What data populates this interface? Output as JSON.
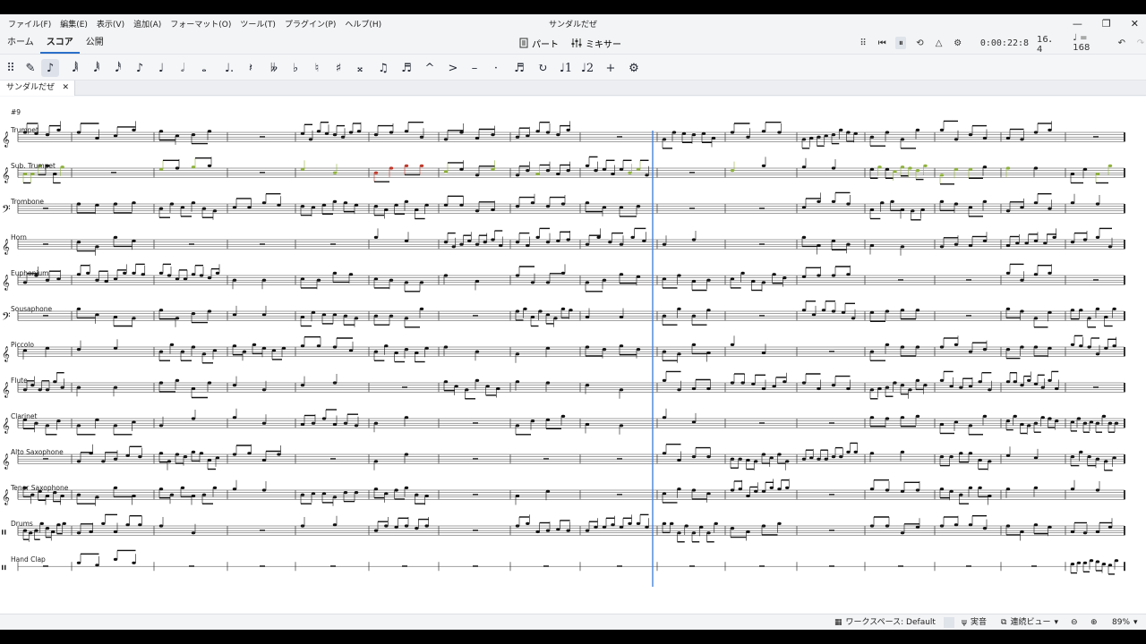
{
  "window": {
    "title": "サンダルだぜ",
    "menus": [
      "ファイル(F)",
      "編集(E)",
      "表示(V)",
      "追加(A)",
      "フォーマット(O)",
      "ツール(T)",
      "プラグイン(P)",
      "ヘルプ(H)"
    ],
    "controls": {
      "minimize": "—",
      "maximize": "❐",
      "close": "✕"
    }
  },
  "nav": {
    "tabs": [
      {
        "label": "ホーム",
        "active": false
      },
      {
        "label": "スコア",
        "active": true
      },
      {
        "label": "公開",
        "active": false
      }
    ],
    "parts_label": "パート",
    "mixer_label": "ミキサー"
  },
  "transport": {
    "time": "0:00:22:8",
    "measure_beat": "16．4",
    "tempo": "♩ = 168"
  },
  "toolbar": {
    "tools": [
      {
        "name": "grip-icon",
        "glyph": "⠿"
      },
      {
        "name": "pen-icon",
        "glyph": "✎"
      },
      {
        "name": "note-input-icon",
        "glyph": "♪"
      },
      {
        "name": "64th-note-icon",
        "glyph": "𝅘𝅥𝅲"
      },
      {
        "name": "32nd-note-icon",
        "glyph": "𝅘𝅥𝅱"
      },
      {
        "name": "16th-note-icon",
        "glyph": "𝅘𝅥𝅰"
      },
      {
        "name": "eighth-note-icon",
        "glyph": "♪"
      },
      {
        "name": "quarter-note-icon",
        "glyph": "♩"
      },
      {
        "name": "half-note-icon",
        "glyph": "𝅗𝅥"
      },
      {
        "name": "whole-note-icon",
        "glyph": "𝅝"
      },
      {
        "name": "dotted-note-icon",
        "glyph": "♩."
      },
      {
        "name": "rest-icon",
        "glyph": "𝄽"
      },
      {
        "name": "double-flat-icon",
        "glyph": "𝄫"
      },
      {
        "name": "flat-icon",
        "glyph": "♭"
      },
      {
        "name": "natural-icon",
        "glyph": "♮"
      },
      {
        "name": "sharp-icon",
        "glyph": "♯"
      },
      {
        "name": "double-sharp-icon",
        "glyph": "𝄪"
      },
      {
        "name": "tie-icon",
        "glyph": "♫"
      },
      {
        "name": "slur-icon",
        "glyph": "♬"
      },
      {
        "name": "marcato-icon",
        "glyph": "^"
      },
      {
        "name": "accent-icon",
        "glyph": ">"
      },
      {
        "name": "tenuto-icon",
        "glyph": "–"
      },
      {
        "name": "staccato-icon",
        "glyph": "·"
      },
      {
        "name": "tuplet-icon",
        "glyph": "♬"
      },
      {
        "name": "flip-icon",
        "glyph": "↻"
      },
      {
        "name": "voice-1-icon",
        "glyph": "♩1"
      },
      {
        "name": "voice-2-icon",
        "glyph": "♩2"
      },
      {
        "name": "add-icon",
        "glyph": "+"
      },
      {
        "name": "customize-icon",
        "glyph": "⚙"
      }
    ]
  },
  "document_tab": {
    "label": "サンダルだぜ",
    "close": "✕"
  },
  "score": {
    "rehearsal_mark": "#9",
    "instruments": [
      {
        "name": "Trumpet",
        "clef": "treble"
      },
      {
        "name": "Sub. Trumpet",
        "clef": "treble"
      },
      {
        "name": "Trombone",
        "clef": "bass"
      },
      {
        "name": "Horn",
        "clef": "treble"
      },
      {
        "name": "Euphonium",
        "clef": "treble"
      },
      {
        "name": "Sousaphone",
        "clef": "bass"
      },
      {
        "name": "Piccolo",
        "clef": "treble"
      },
      {
        "name": "Flute",
        "clef": "treble"
      },
      {
        "name": "Clarinet",
        "clef": "treble"
      },
      {
        "name": "Alto Saxophone",
        "clef": "treble"
      },
      {
        "name": "Tenor Saxophone",
        "clef": "treble"
      },
      {
        "name": "Drums",
        "clef": "percussion"
      },
      {
        "name": "Hand Clap",
        "clef": "percussion"
      }
    ],
    "time_signature": "4/4",
    "playback_measure": 10
  },
  "status": {
    "workspace": "ワークスペース: Default",
    "concert_pitch": "実音",
    "view_mode": "連続ビュー",
    "zoom": "89%"
  },
  "colors": {
    "accent": "#2b6fc9",
    "playback_line": "#3a7bd5",
    "note_out_of_range": "#8fb23c",
    "note_error": "#c0392b"
  }
}
